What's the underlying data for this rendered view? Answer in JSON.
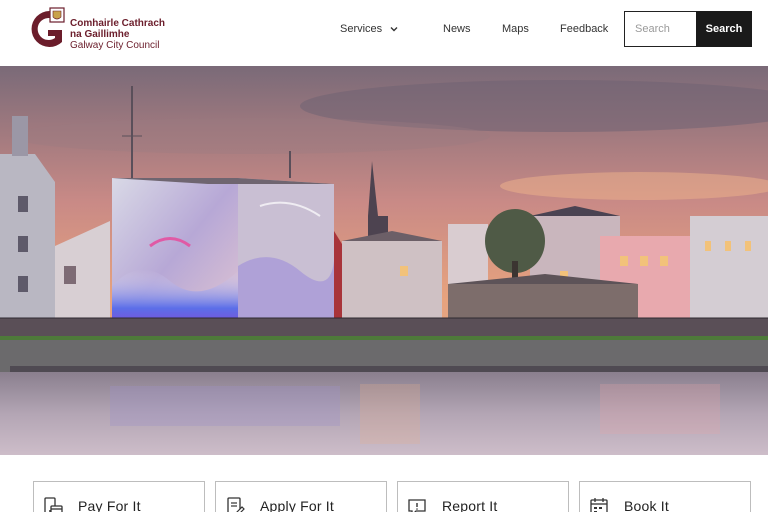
{
  "brand": {
    "line1": "Comhairle Cathrach",
    "line2": "na Gaillimhe",
    "line3": "Galway City Council",
    "color": "#6b1d2b"
  },
  "nav": {
    "services": "Services",
    "news": "News",
    "maps": "Maps",
    "feedback": "Feedback"
  },
  "search": {
    "placeholder": "Search",
    "button": "Search"
  },
  "cards": [
    {
      "label": "Pay For It",
      "icon": "payment-icon"
    },
    {
      "label": "Apply For It",
      "icon": "apply-document-icon"
    },
    {
      "label": "Report It",
      "icon": "report-chat-icon"
    },
    {
      "label": "Book It",
      "icon": "calendar-icon"
    }
  ]
}
